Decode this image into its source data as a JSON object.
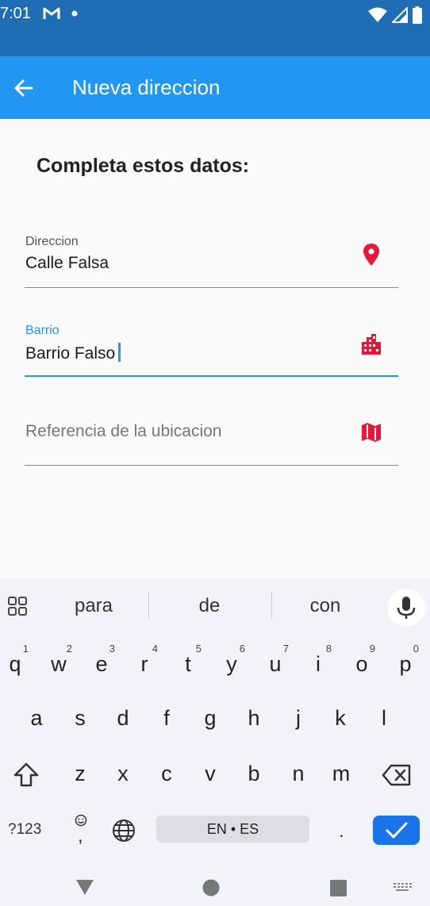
{
  "status_bar": {
    "time": "7:01",
    "left_icons": [
      "gmail-icon",
      "notification-dot-icon"
    ],
    "right_icons": [
      "wifi-icon",
      "signal-icon",
      "battery-icon"
    ]
  },
  "app_bar": {
    "title": "Nueva direccion",
    "back_icon": "arrow-back-icon"
  },
  "form": {
    "heading": "Completa estos datos:",
    "fields": [
      {
        "label": "Direccion",
        "value": "Calle Falsa",
        "icon": "location-pin-icon",
        "focused": false
      },
      {
        "label": "Barrio",
        "value": "Barrio Falso",
        "icon": "city-building-icon",
        "focused": true
      },
      {
        "label": "",
        "placeholder": "Referencia de la ubicacion",
        "value": "",
        "icon": "map-icon",
        "focused": false
      }
    ],
    "accent_color": "#2196f3",
    "icon_color": "#e8173a"
  },
  "keyboard": {
    "suggestions": [
      "para",
      "de",
      "con"
    ],
    "row1": [
      {
        "key": "q",
        "hint": "1"
      },
      {
        "key": "w",
        "hint": "2"
      },
      {
        "key": "e",
        "hint": "3"
      },
      {
        "key": "r",
        "hint": "4"
      },
      {
        "key": "t",
        "hint": "5"
      },
      {
        "key": "y",
        "hint": "6"
      },
      {
        "key": "u",
        "hint": "7"
      },
      {
        "key": "i",
        "hint": "8"
      },
      {
        "key": "o",
        "hint": "9"
      },
      {
        "key": "p",
        "hint": "0"
      }
    ],
    "row2": [
      "a",
      "s",
      "d",
      "f",
      "g",
      "h",
      "j",
      "k",
      "l"
    ],
    "row3": [
      "z",
      "x",
      "c",
      "v",
      "b",
      "n",
      "m"
    ],
    "symbols_label": "?123",
    "emoji_comma": ",",
    "space_label": "EN • ES",
    "period": ".",
    "enter_color": "#1a73e8"
  },
  "nav_bar": {
    "icons": [
      "back-triangle-icon",
      "home-circle-icon",
      "recents-square-icon",
      "keyboard-switch-icon"
    ]
  }
}
